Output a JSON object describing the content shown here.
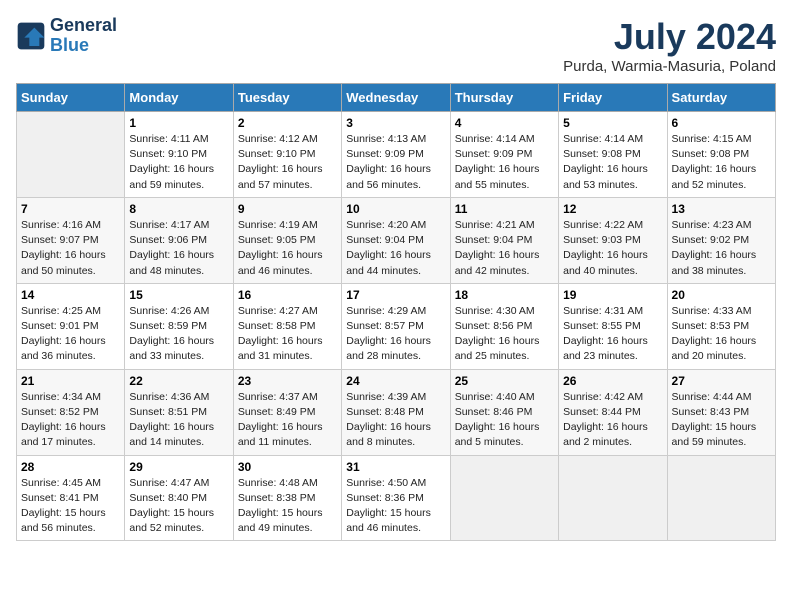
{
  "header": {
    "logo_line1": "General",
    "logo_line2": "Blue",
    "title": "July 2024",
    "subtitle": "Purda, Warmia-Masuria, Poland"
  },
  "days_of_week": [
    "Sunday",
    "Monday",
    "Tuesday",
    "Wednesday",
    "Thursday",
    "Friday",
    "Saturday"
  ],
  "weeks": [
    [
      {
        "day": "",
        "info": ""
      },
      {
        "day": "1",
        "info": "Sunrise: 4:11 AM\nSunset: 9:10 PM\nDaylight: 16 hours\nand 59 minutes."
      },
      {
        "day": "2",
        "info": "Sunrise: 4:12 AM\nSunset: 9:10 PM\nDaylight: 16 hours\nand 57 minutes."
      },
      {
        "day": "3",
        "info": "Sunrise: 4:13 AM\nSunset: 9:09 PM\nDaylight: 16 hours\nand 56 minutes."
      },
      {
        "day": "4",
        "info": "Sunrise: 4:14 AM\nSunset: 9:09 PM\nDaylight: 16 hours\nand 55 minutes."
      },
      {
        "day": "5",
        "info": "Sunrise: 4:14 AM\nSunset: 9:08 PM\nDaylight: 16 hours\nand 53 minutes."
      },
      {
        "day": "6",
        "info": "Sunrise: 4:15 AM\nSunset: 9:08 PM\nDaylight: 16 hours\nand 52 minutes."
      }
    ],
    [
      {
        "day": "7",
        "info": "Sunrise: 4:16 AM\nSunset: 9:07 PM\nDaylight: 16 hours\nand 50 minutes."
      },
      {
        "day": "8",
        "info": "Sunrise: 4:17 AM\nSunset: 9:06 PM\nDaylight: 16 hours\nand 48 minutes."
      },
      {
        "day": "9",
        "info": "Sunrise: 4:19 AM\nSunset: 9:05 PM\nDaylight: 16 hours\nand 46 minutes."
      },
      {
        "day": "10",
        "info": "Sunrise: 4:20 AM\nSunset: 9:04 PM\nDaylight: 16 hours\nand 44 minutes."
      },
      {
        "day": "11",
        "info": "Sunrise: 4:21 AM\nSunset: 9:04 PM\nDaylight: 16 hours\nand 42 minutes."
      },
      {
        "day": "12",
        "info": "Sunrise: 4:22 AM\nSunset: 9:03 PM\nDaylight: 16 hours\nand 40 minutes."
      },
      {
        "day": "13",
        "info": "Sunrise: 4:23 AM\nSunset: 9:02 PM\nDaylight: 16 hours\nand 38 minutes."
      }
    ],
    [
      {
        "day": "14",
        "info": "Sunrise: 4:25 AM\nSunset: 9:01 PM\nDaylight: 16 hours\nand 36 minutes."
      },
      {
        "day": "15",
        "info": "Sunrise: 4:26 AM\nSunset: 8:59 PM\nDaylight: 16 hours\nand 33 minutes."
      },
      {
        "day": "16",
        "info": "Sunrise: 4:27 AM\nSunset: 8:58 PM\nDaylight: 16 hours\nand 31 minutes."
      },
      {
        "day": "17",
        "info": "Sunrise: 4:29 AM\nSunset: 8:57 PM\nDaylight: 16 hours\nand 28 minutes."
      },
      {
        "day": "18",
        "info": "Sunrise: 4:30 AM\nSunset: 8:56 PM\nDaylight: 16 hours\nand 25 minutes."
      },
      {
        "day": "19",
        "info": "Sunrise: 4:31 AM\nSunset: 8:55 PM\nDaylight: 16 hours\nand 23 minutes."
      },
      {
        "day": "20",
        "info": "Sunrise: 4:33 AM\nSunset: 8:53 PM\nDaylight: 16 hours\nand 20 minutes."
      }
    ],
    [
      {
        "day": "21",
        "info": "Sunrise: 4:34 AM\nSunset: 8:52 PM\nDaylight: 16 hours\nand 17 minutes."
      },
      {
        "day": "22",
        "info": "Sunrise: 4:36 AM\nSunset: 8:51 PM\nDaylight: 16 hours\nand 14 minutes."
      },
      {
        "day": "23",
        "info": "Sunrise: 4:37 AM\nSunset: 8:49 PM\nDaylight: 16 hours\nand 11 minutes."
      },
      {
        "day": "24",
        "info": "Sunrise: 4:39 AM\nSunset: 8:48 PM\nDaylight: 16 hours\nand 8 minutes."
      },
      {
        "day": "25",
        "info": "Sunrise: 4:40 AM\nSunset: 8:46 PM\nDaylight: 16 hours\nand 5 minutes."
      },
      {
        "day": "26",
        "info": "Sunrise: 4:42 AM\nSunset: 8:44 PM\nDaylight: 16 hours\nand 2 minutes."
      },
      {
        "day": "27",
        "info": "Sunrise: 4:44 AM\nSunset: 8:43 PM\nDaylight: 15 hours\nand 59 minutes."
      }
    ],
    [
      {
        "day": "28",
        "info": "Sunrise: 4:45 AM\nSunset: 8:41 PM\nDaylight: 15 hours\nand 56 minutes."
      },
      {
        "day": "29",
        "info": "Sunrise: 4:47 AM\nSunset: 8:40 PM\nDaylight: 15 hours\nand 52 minutes."
      },
      {
        "day": "30",
        "info": "Sunrise: 4:48 AM\nSunset: 8:38 PM\nDaylight: 15 hours\nand 49 minutes."
      },
      {
        "day": "31",
        "info": "Sunrise: 4:50 AM\nSunset: 8:36 PM\nDaylight: 15 hours\nand 46 minutes."
      },
      {
        "day": "",
        "info": ""
      },
      {
        "day": "",
        "info": ""
      },
      {
        "day": "",
        "info": ""
      }
    ]
  ]
}
